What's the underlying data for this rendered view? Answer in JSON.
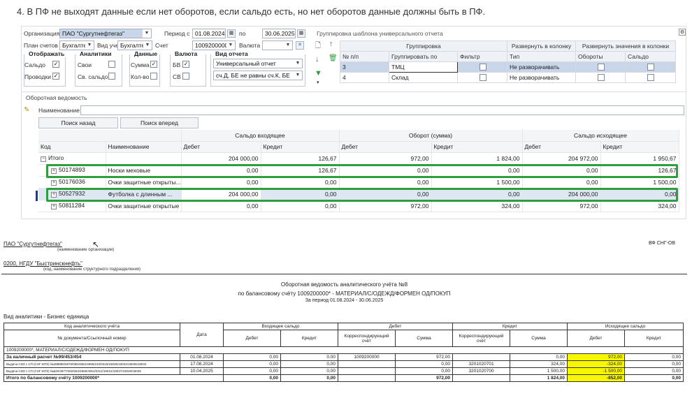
{
  "heading": "4. В ПФ не выходят данные если нет оборотов, если сальдо есть, но нет оборотов данные должны быть в ПФ.",
  "top": {
    "org_label": "Организация",
    "org_value": "ПАО \"Сургутнефтегаз\"",
    "period_label": "Период с",
    "date_from": "01.08.2024",
    "to_label": "по",
    "date_to": "30.06.2025",
    "plan_label": "План счетов",
    "plan_value": "Бухгалте",
    "vid_label": "Вид учета",
    "vid_value": "Бухгалте",
    "schet_label": "Счет",
    "schet_value": "1009200000",
    "val_label": "Валюта",
    "val_value": ""
  },
  "groups": {
    "otobr": "Отображать",
    "saldo": "Сальдо",
    "provodki": "Проводки",
    "analit": "Аналитики",
    "svoi": "Свои",
    "svsaldo": "Св. сальдо",
    "dannye": "Данные",
    "summa": "Сумма",
    "kolvo": "Кол-во",
    "valuta": "Валюта",
    "bv": "БВ",
    "sv": "СВ",
    "report_type": "Вид отчета",
    "report_value": "Универсальный отчет",
    "filter_value": "сч.Д, БЕ не равны сч.К, БЕ"
  },
  "template": {
    "title": "Группировка шаблона универсального отчета",
    "cols": [
      "№ п/п",
      "Группировать по",
      "Фильтр",
      "Тип",
      "Обороты",
      "Сальдо"
    ],
    "groupcol": "Группировка",
    "expand": "Развернуть в колонку",
    "expandvals": "Развернуть значения в колонки",
    "rows": [
      {
        "n": "3",
        "by": "ТМЦ",
        "type": "Не разворачивать"
      },
      {
        "n": "4",
        "by": "Склад",
        "type": "Не разворачивать"
      }
    ]
  },
  "grid": {
    "pane_title": "Оборотная ведомость",
    "name_label": "Наименование",
    "search_back": "Поиск назад",
    "search_fwd": "Поиск вперед",
    "h_open": "Сальдо входящее",
    "h_turn": "Оборот (сумма)",
    "h_close": "Сальдо исходящее",
    "c_code": "Код",
    "c_name": "Наименование",
    "debit": "Дебет",
    "credit": "Кредит",
    "rows": [
      {
        "code": "Итого",
        "name": "",
        "a": "204 000,00",
        "b": "126,67",
        "c": "972,00",
        "d": "1 824,00",
        "e": "204 972,00",
        "f": "1 950,67"
      },
      {
        "code": "50174893",
        "name": "Носки меховые",
        "a": "0,00",
        "b": "126,67",
        "c": "0,00",
        "d": "0,00",
        "e": "0,00",
        "f": "126,67"
      },
      {
        "code": "50176036",
        "name": "Очки защитные открыты...",
        "a": "0,00",
        "b": "0,00",
        "c": "0,00",
        "d": "1 500,00",
        "e": "0,00",
        "f": "1 500,00"
      },
      {
        "code": "50527932",
        "name": "Футболка с длинным ...",
        "a": "204 000,00",
        "b": "0,00",
        "c": "0,00",
        "d": "0,00",
        "e": "204 000,00",
        "f": "0,00"
      },
      {
        "code": "50811284",
        "name": "Очки защитные открытые",
        "a": "0,00",
        "b": "0,00",
        "c": "972,00",
        "d": "324,00",
        "e": "972,00",
        "f": "324,00"
      }
    ]
  },
  "report": {
    "org": "ПАО \"Сургутнефтегаз\"",
    "org_sub": "(наименование организации)",
    "dep": "0200, НГДУ \"Быстринскнефть\"",
    "dep_sub": "(код, наименование структурного подразделения)",
    "code": "ВФ СНГ-ОВ",
    "t1": "Оборотная ведомость аналитического учёта №8",
    "t2": "по балансовому счёту 1009200000* - МАТЕРИАЛ/С/ОДЕЖД/ФОРМЕН ОД/ПОКУП",
    "t3": "За период 01.08.2024 - 30.06.2025",
    "vid": "Вид аналитики -   Бизнес единица",
    "h_code": "Код аналитического учёта",
    "h_doc": "№ документа/Ссылочный номер",
    "h_date": "Дата",
    "h_in": "Входящее сальдо",
    "h_deb": "Дебет",
    "h_cred": "Кредит",
    "h_out": "Исходящее сальдо",
    "h_corr": "Корреспондирующий счёт",
    "h_sum": "Сумма",
    "debit": "Дебет",
    "credit": "Кредит",
    "acc": "1009200000*, МАТЕРИАЛ/С/ОДЕЖД/ФОРМЕН ОД/ПОКУП",
    "rows": [
      {
        "doc": "За наличный расчет №99/453/454",
        "date": "01.08.2024",
        "inD": "0,00",
        "inC": "0,00",
        "dCorr": "1009200000",
        "dSum": "972,00",
        "cCorr": "",
        "cSum": "0,00",
        "oD": "972,00",
        "oC": "0,00"
      },
      {
        "doc": "Выдача СИЗ с СП (СНГ-МТЗ) №488880/4876/055/4862/4966/210/0315/18035/18032/18036/18034",
        "date": "17.08.2024",
        "inD": "0,00",
        "inC": "0,00",
        "dCorr": "",
        "dSum": "0,00",
        "cCorr": "3201020701",
        "cSum": "324,00",
        "oD": "-324,00",
        "oC": "0,00"
      },
      {
        "doc": "Выдача СИЗ с СП (СНГ-МТЗ) №в20/4877/202/554/4965/4061/0314/18031/18037/18028/18039",
        "date": "10.04.2025",
        "inD": "0,00",
        "inC": "0,00",
        "dCorr": "",
        "dSum": "0,00",
        "cCorr": "3201020700",
        "cSum": "1 500,00",
        "oD": "-1 500,00",
        "oC": "0,00"
      }
    ],
    "total_label": "Итого по балансовому счёту 1009200000*",
    "total": {
      "inD": "0,00",
      "inC": "0,00",
      "dSum": "972,00",
      "cSum": "1 824,00",
      "oD": "-852,00",
      "oC": "0,00"
    }
  },
  "colors": {
    "highlight": "#2f9e3f",
    "marker": "#f6f700"
  }
}
